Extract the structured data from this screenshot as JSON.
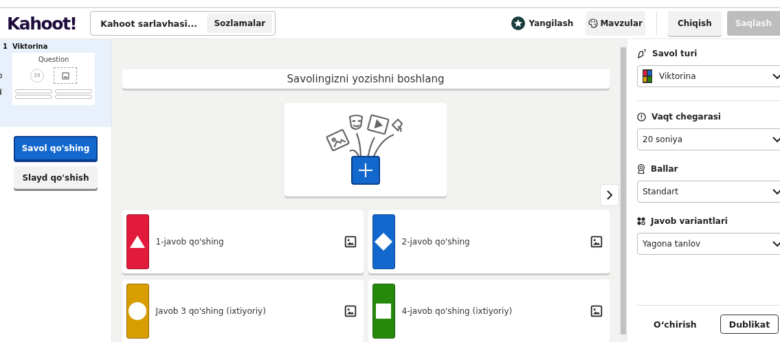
{
  "header": {
    "logo": "Kahoot!",
    "title": "Kahoot sarlavhasi...",
    "settings_button": "Sozlamalar",
    "upgrade_button": "Yangilash",
    "themes_button": "Mavzular",
    "exit_button": "Chiqish",
    "save_button": "Saqlash"
  },
  "sidebar": {
    "slides": [
      {
        "number": "1",
        "type": "Viktorina",
        "thumbnail_title": "Question",
        "thumbnail_timer": "20",
        "selected": true
      }
    ],
    "add_question_button": "Savol qo'shing",
    "add_slide_button": "Slayd qo'shish"
  },
  "editor": {
    "question_placeholder": "Savolingizni yozishni boshlang",
    "answers": [
      {
        "placeholder": "1-javob qo'shing",
        "kind": "triangle",
        "color": "#e21b3c"
      },
      {
        "placeholder": "2-javob qo'shing",
        "kind": "diamond",
        "color": "#1368ce"
      },
      {
        "placeholder": "Javob 3 qo'shing (ixtiyoriy)",
        "kind": "circle",
        "color": "#d89e00"
      },
      {
        "placeholder": "4-javob qo'shing (ixtiyoriy)",
        "kind": "square",
        "color": "#26890c"
      }
    ]
  },
  "settings_panel": {
    "sections": [
      {
        "label": "Savol turi",
        "kind": "type",
        "value": "Viktorina"
      },
      {
        "label": "Vaqt chegarasi",
        "kind": "time",
        "value": "20 soniya"
      },
      {
        "label": "Ballar",
        "kind": "points",
        "value": "Standart"
      },
      {
        "label": "Javob variantlari",
        "kind": "options",
        "value": "Yagona tanlov"
      }
    ],
    "delete_button": "O‘chirish",
    "duplicate_button": "Dublikat"
  }
}
